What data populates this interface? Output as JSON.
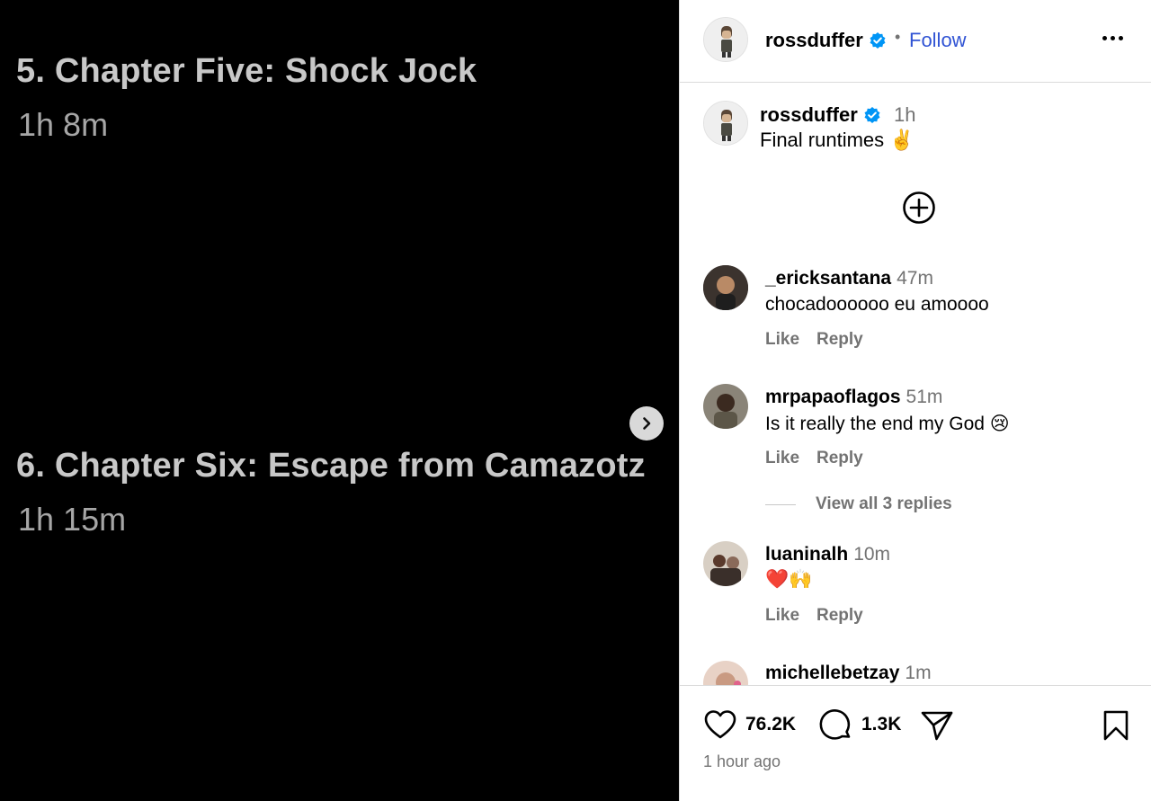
{
  "media": {
    "episode5_title": "5. Chapter Five: Shock Jock",
    "episode5_runtime": "1h 8m",
    "episode6_title": "6. Chapter Six: Escape from Camazotz",
    "episode6_runtime": "1h 15m"
  },
  "header": {
    "username": "rossduffer",
    "separator": "•",
    "follow_label": "Follow"
  },
  "caption": {
    "username": "rossduffer",
    "time": "1h",
    "text": "Final runtimes ✌️"
  },
  "comments": [
    {
      "username": "_ericksantana",
      "time": "47m",
      "text": "chocadoooooo eu amoooo",
      "like": "Like",
      "reply": "Reply"
    },
    {
      "username": "mrpapaoflagos",
      "time": "51m",
      "text": "Is it really the end my God 😢",
      "like": "Like",
      "reply": "Reply"
    },
    {
      "username": "luaninalh",
      "time": "10m",
      "text": "❤️🙌",
      "like": "Like",
      "reply": "Reply"
    },
    {
      "username": "michellebetzay",
      "time": "1m"
    }
  ],
  "view_replies": "View all 3 replies",
  "footer": {
    "likes": "76.2K",
    "comments": "1.3K",
    "posted": "1 hour ago"
  },
  "colors": {
    "follow_blue": "#3154d4",
    "verified_blue": "#0095f6",
    "muted_text": "#737373"
  }
}
